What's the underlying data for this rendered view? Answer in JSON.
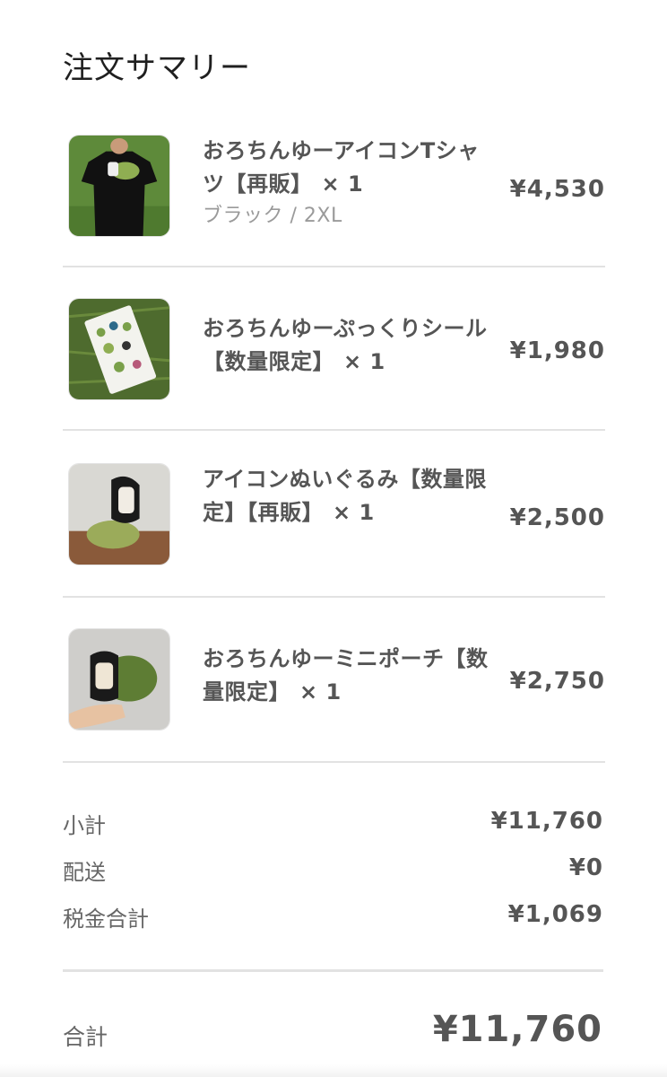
{
  "summary": {
    "title": "注文サマリー"
  },
  "items": [
    {
      "name": "おろちんゆーアイコンTシャツ【再販】",
      "qty": "× 1",
      "variant": "ブラック / 2XL",
      "price": "¥4,530",
      "thumb": "t-shirt-photo"
    },
    {
      "name": "おろちんゆーぷっくりシール【数量限定】",
      "qty": "× 1",
      "variant": "",
      "price": "¥1,980",
      "thumb": "sticker-sheet-photo"
    },
    {
      "name": "アイコンぬいぐるみ【数量限定】【再販】",
      "qty": "× 1",
      "variant": "",
      "price": "¥2,500",
      "thumb": "plush-toy-photo"
    },
    {
      "name": "おろちんゆーミニポーチ【数量限定】",
      "qty": "× 1",
      "variant": "",
      "price": "¥2,750",
      "thumb": "mini-pouch-photo"
    }
  ],
  "totals": {
    "subtotal_label": "小計",
    "subtotal": "¥11,760",
    "shipping_label": "配送",
    "shipping": "¥0",
    "tax_label": "税金合計",
    "tax": "¥1,069",
    "total_label": "合計",
    "total": "¥11,760"
  }
}
